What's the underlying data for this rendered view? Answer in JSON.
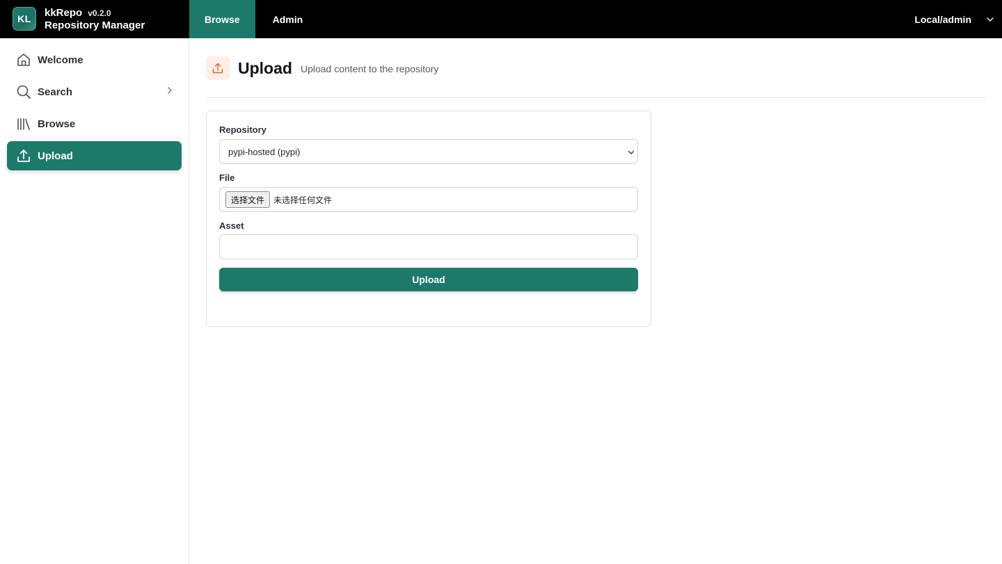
{
  "brand": {
    "logo_text": "KL",
    "name": "kkRepo",
    "version": "v0.2.0",
    "subtitle": "Repository Manager"
  },
  "topnav": {
    "items": [
      {
        "label": "Browse",
        "active": true
      },
      {
        "label": "Admin",
        "active": false
      }
    ]
  },
  "user": {
    "label": "Local/admin",
    "icon": "chevron-down-icon"
  },
  "sidebar": {
    "items": [
      {
        "label": "Welcome",
        "icon": "home-icon",
        "active": false
      },
      {
        "label": "Search",
        "icon": "search-icon",
        "active": false,
        "has_submenu": true
      },
      {
        "label": "Browse",
        "icon": "library-icon",
        "active": false
      },
      {
        "label": "Upload",
        "icon": "upload-icon",
        "active": true
      }
    ]
  },
  "page": {
    "icon": "upload-icon",
    "title": "Upload",
    "subtitle": "Upload content to the repository"
  },
  "form": {
    "repository_label": "Repository",
    "repository_value": "pypi-hosted (pypi)",
    "file_label": "File",
    "file_button": "选择文件",
    "file_status": "未选择任何文件",
    "asset_label": "Asset",
    "asset_value": "",
    "submit_label": "Upload"
  },
  "colors": {
    "accent": "#1d7a6b",
    "topbar_bg": "#000000",
    "header_icon_bg": "#fdeee6",
    "header_icon_stroke": "#c2703d"
  }
}
